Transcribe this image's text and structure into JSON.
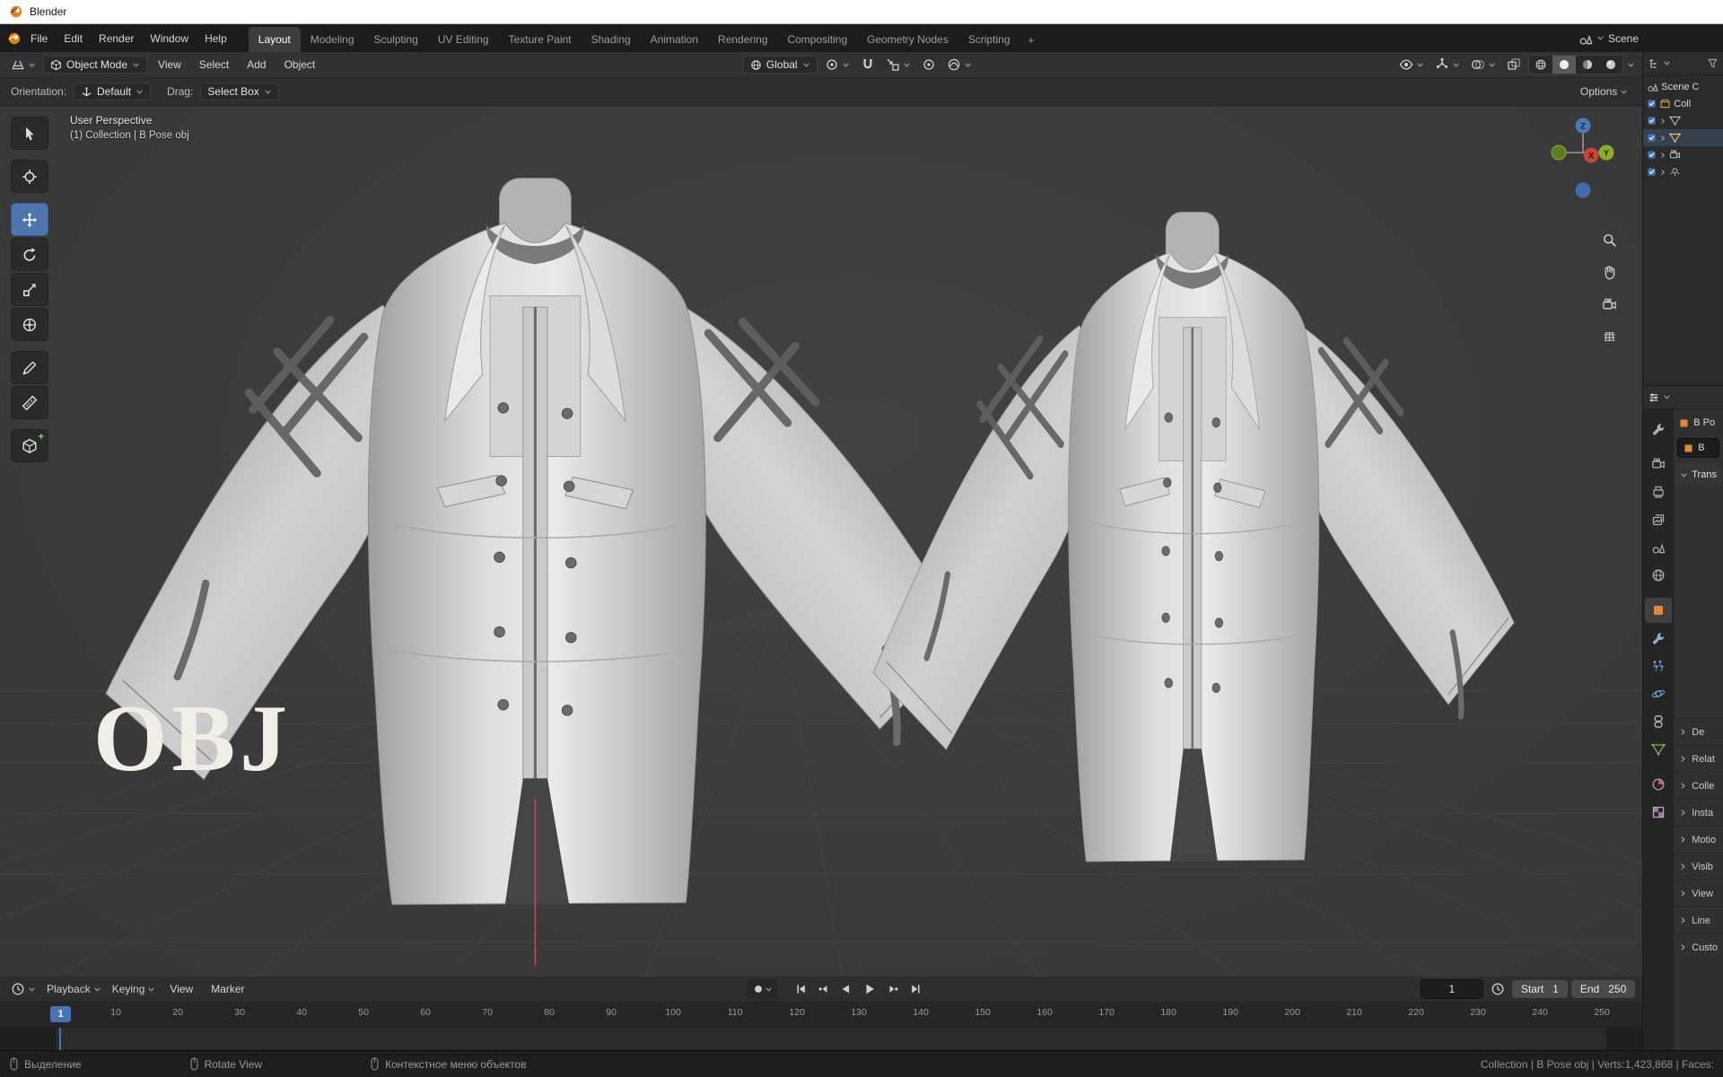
{
  "titlebar": {
    "app_name": "Blender"
  },
  "menubar": {
    "menus": [
      "File",
      "Edit",
      "Render",
      "Window",
      "Help"
    ],
    "workspaces": [
      "Layout",
      "Modeling",
      "Sculpting",
      "UV Editing",
      "Texture Paint",
      "Shading",
      "Animation",
      "Rendering",
      "Compositing",
      "Geometry Nodes",
      "Scripting"
    ],
    "active_workspace": "Layout",
    "add_tab": "+",
    "scene_name": "Scene"
  },
  "viewport_header": {
    "mode": "Object Mode",
    "menus": [
      "View",
      "Select",
      "Add",
      "Object"
    ],
    "orientation": "Global"
  },
  "tool_settings": {
    "orientation_label": "Orientation:",
    "orientation_value": "Default",
    "drag_label": "Drag:",
    "drag_value": "Select Box",
    "options_label": "Options"
  },
  "viewport": {
    "overlay_line1": "User Perspective",
    "overlay_line2": "(1) Collection | B Pose obj",
    "watermark": "OBJ",
    "gizmo": {
      "x": "X",
      "y": "Y",
      "z": "Z"
    }
  },
  "outliner": {
    "scene_label": "Scene C",
    "collection_label": "Coll"
  },
  "properties": {
    "object_name": "B Po",
    "data_name": "B",
    "transform_section": "Trans",
    "sections": [
      "De",
      "Relat",
      "Colle",
      "Insta",
      "Motio",
      "Visib",
      "View",
      "Line",
      "Custo"
    ]
  },
  "timeline": {
    "menus": [
      "Playback",
      "Keying",
      "View",
      "Marker"
    ],
    "current_frame": "1",
    "playhead_label": "1",
    "start_label": "Start",
    "start_value": "1",
    "end_label": "End",
    "end_value": "250",
    "ticks": [
      "10",
      "20",
      "30",
      "40",
      "50",
      "60",
      "70",
      "80",
      "90",
      "100",
      "110",
      "120",
      "130",
      "140",
      "150",
      "160",
      "170",
      "180",
      "190",
      "200",
      "210",
      "220",
      "230",
      "240",
      "250"
    ]
  },
  "statusbar": {
    "items": [
      "Выделение",
      "Rotate View",
      "Контекстное меню объектов"
    ],
    "right_text": "Collection | B Pose obj | Verts:1,423,868 | Faces:"
  },
  "colors": {
    "accent_blue": "#4772b3",
    "blender_orange": "#e87d0d"
  }
}
